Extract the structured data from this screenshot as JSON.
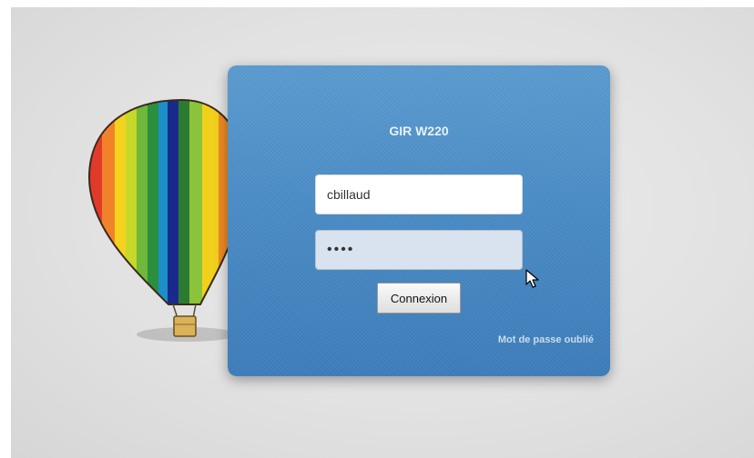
{
  "login": {
    "title": "GIR W220",
    "username_value": "cbillaud",
    "password_value": "••••",
    "submit_label": "Connexion",
    "forgot_password_label": "Mot de passe oublié"
  },
  "colors": {
    "panel": "#4a8cc6",
    "page_background": "#e2e2e2"
  },
  "icons": {
    "logo": "hot-air-balloon-icon",
    "pointer": "mouse-cursor-icon"
  }
}
